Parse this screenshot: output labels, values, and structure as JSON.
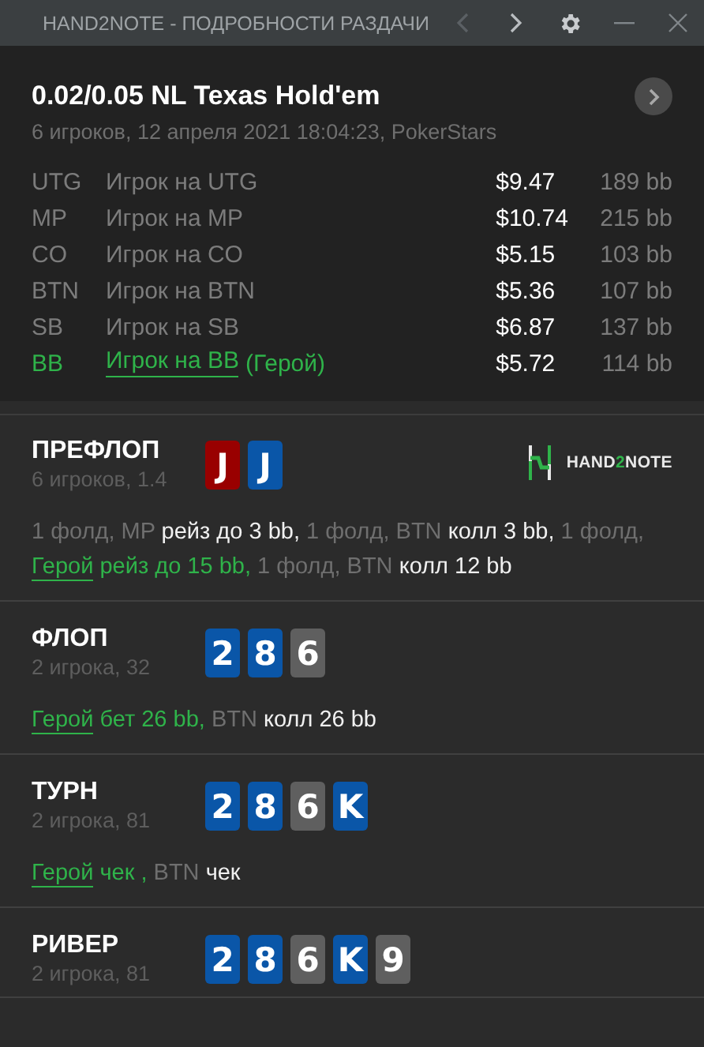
{
  "window": {
    "title": "HAND2NOTE - ПОДРОБНОСТИ РАЗДАЧИ",
    "nav": [
      {
        "kind": "prev",
        "disabled": true
      },
      {
        "kind": "next",
        "disabled": false
      }
    ]
  },
  "hand": {
    "title": "0.02/0.05 NL Texas Hold'em",
    "subtitle": "6 игроков, 12 апреля 2021 18:04:23, PokerStars"
  },
  "players": [
    {
      "position": "UTG",
      "name": "Игрок на UTG",
      "stack": "$9.47",
      "bb": "189 bb",
      "hero": false
    },
    {
      "position": "MP",
      "name": "Игрок на MP",
      "stack": "$10.74",
      "bb": "215 bb",
      "hero": false
    },
    {
      "position": "CO",
      "name": "Игрок на CO",
      "stack": "$5.15",
      "bb": "103 bb",
      "hero": false
    },
    {
      "position": "BTN",
      "name": "Игрок на BTN",
      "stack": "$5.36",
      "bb": "107 bb",
      "hero": false
    },
    {
      "position": "SB",
      "name": "Игрок на SB",
      "stack": "$6.87",
      "bb": "137 bb",
      "hero": false
    },
    {
      "position": "BB",
      "name": "Игрок на BB",
      "tag": "(Герой)",
      "stack": "$5.72",
      "bb": "114 bb",
      "hero": true
    }
  ],
  "streets": [
    {
      "name": "ПРЕФЛОП",
      "info": "6 игроков, 1.4",
      "cards": [
        {
          "rank": "J",
          "color": "#990000"
        },
        {
          "rank": "J",
          "color": "#0a56a8"
        }
      ],
      "logo": [
        "HAND",
        "2",
        "NOTE"
      ],
      "actions": [
        {
          "text": "1 фолд, MP",
          "kind": "plain"
        },
        {
          "text": "рейз до 3 bb,",
          "kind": "bold"
        },
        {
          "text": "1 фолд, BTN",
          "kind": "plain"
        },
        {
          "text": "колл 3 bb,",
          "kind": "bold"
        },
        {
          "text": "1 фолд,",
          "kind": "plain"
        },
        {
          "text": "Герой",
          "kind": "hero_link"
        },
        {
          "text": "рейз до 15 bb,",
          "kind": "hero"
        },
        {
          "text": "1 фолд, BTN",
          "kind": "plain"
        },
        {
          "text": "колл 12 bb",
          "kind": "bold"
        }
      ]
    },
    {
      "name": "ФЛОП",
      "info": "2 игрока, 32",
      "cards": [
        {
          "rank": "2",
          "color": "#0a56a8"
        },
        {
          "rank": "8",
          "color": "#0a56a8"
        },
        {
          "rank": "6",
          "color": "#5f5f5f"
        }
      ],
      "actions": [
        {
          "text": "Герой",
          "kind": "hero_link"
        },
        {
          "text": "бет 26 bb,",
          "kind": "hero"
        },
        {
          "text": "BTN",
          "kind": "plain"
        },
        {
          "text": "колл 26 bb",
          "kind": "bold"
        }
      ]
    },
    {
      "name": "ТУРН",
      "info": "2 игрока, 81",
      "cards": [
        {
          "rank": "2",
          "color": "#0a56a8"
        },
        {
          "rank": "8",
          "color": "#0a56a8"
        },
        {
          "rank": "6",
          "color": "#5f5f5f"
        },
        {
          "rank": "K",
          "color": "#0a56a8"
        }
      ],
      "actions": [
        {
          "text": "Герой",
          "kind": "hero_link"
        },
        {
          "text": "чек ,",
          "kind": "hero"
        },
        {
          "text": "BTN",
          "kind": "plain"
        },
        {
          "text": "чек",
          "kind": "bold"
        }
      ]
    },
    {
      "name": "РИВЕР",
      "info": "2 игрока, 81",
      "cards": [
        {
          "rank": "2",
          "color": "#0a56a8"
        },
        {
          "rank": "8",
          "color": "#0a56a8"
        },
        {
          "rank": "6",
          "color": "#5f5f5f"
        },
        {
          "rank": "K",
          "color": "#0a56a8"
        },
        {
          "rank": "9",
          "color": "#5f5f5f"
        }
      ]
    }
  ]
}
